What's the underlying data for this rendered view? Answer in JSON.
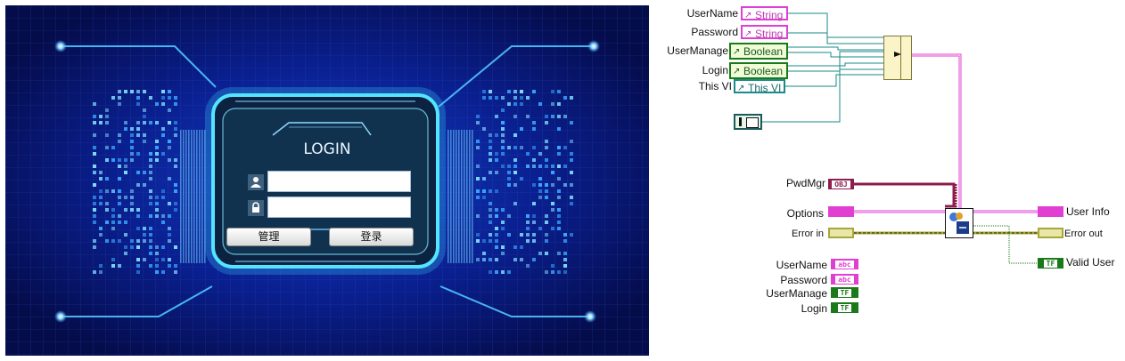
{
  "front_panel": {
    "title": "LOGIN",
    "username_value": "",
    "password_value": "",
    "manage_button_label": "管理",
    "login_button_label": "登录"
  },
  "block_diagram": {
    "property_node": {
      "items": [
        "UserName",
        "Password",
        "UserManage",
        "Login",
        "This VI"
      ],
      "types": [
        "String",
        "String",
        "Boolean",
        "Boolean",
        "This VI"
      ]
    },
    "inputs": {
      "pwdmgr": {
        "label": "PwdMgr",
        "type": "OBJ"
      },
      "options": {
        "label": "Options"
      },
      "error_in": {
        "label": "Error in"
      }
    },
    "outputs": {
      "user_info": {
        "label": "User Info"
      },
      "error_out": {
        "label": "Error out"
      },
      "valid_user": {
        "label": "Valid User",
        "type": "TF"
      }
    },
    "controls": [
      {
        "label": "UserName",
        "type": "abc"
      },
      {
        "label": "Password",
        "type": "abc"
      },
      {
        "label": "UserManage",
        "type": "TF"
      },
      {
        "label": "Login",
        "type": "TF"
      }
    ],
    "colors": {
      "string": "#e13fd3",
      "boolean": "#1a7a1a",
      "refnum": "#1a8a8a",
      "error": "#a7a63a",
      "object": "#8c1d4c"
    }
  }
}
